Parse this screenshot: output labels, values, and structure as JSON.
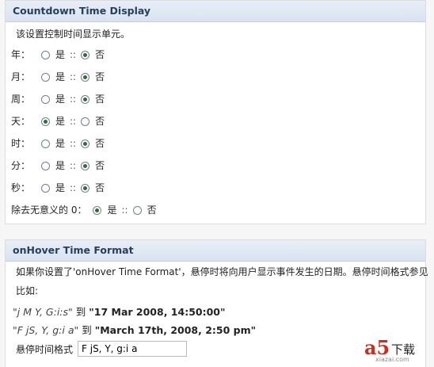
{
  "panel1": {
    "title": "Countdown Time Display",
    "description": "该设置控制时间显示单元。",
    "yes_label": "是",
    "no_label": "否",
    "separator": "::",
    "rows": [
      {
        "label": "年：",
        "selected": "no"
      },
      {
        "label": "月：",
        "selected": "no"
      },
      {
        "label": "周：",
        "selected": "no"
      },
      {
        "label": "天：",
        "selected": "yes"
      },
      {
        "label": "时：",
        "selected": "no"
      },
      {
        "label": "分：",
        "selected": "no"
      },
      {
        "label": "秒：",
        "selected": "no"
      },
      {
        "label": "除去无意义的 0：",
        "selected": "yes"
      }
    ]
  },
  "panel2": {
    "title": "onHover Time Format",
    "description": "如果你设置了'onHover Time Format'，悬停时将向用户显示事件发生的日期。悬停时间格式参见",
    "example_intro": "比如:",
    "connector": "到",
    "examples": [
      {
        "format": "\"j M Y, G:i:s\"",
        "result": "\"17 Mar 2008, 14:50:00\""
      },
      {
        "format": "\"F jS, Y, g:i a\"",
        "result": "\"March 17th, 2008, 2:50 pm\""
      }
    ],
    "field_label": "悬停时间格式",
    "field_value": "F jS, Y, g:i a"
  },
  "watermark": {
    "logo": "a5",
    "text": "下载",
    "url": "xiazai.com"
  }
}
